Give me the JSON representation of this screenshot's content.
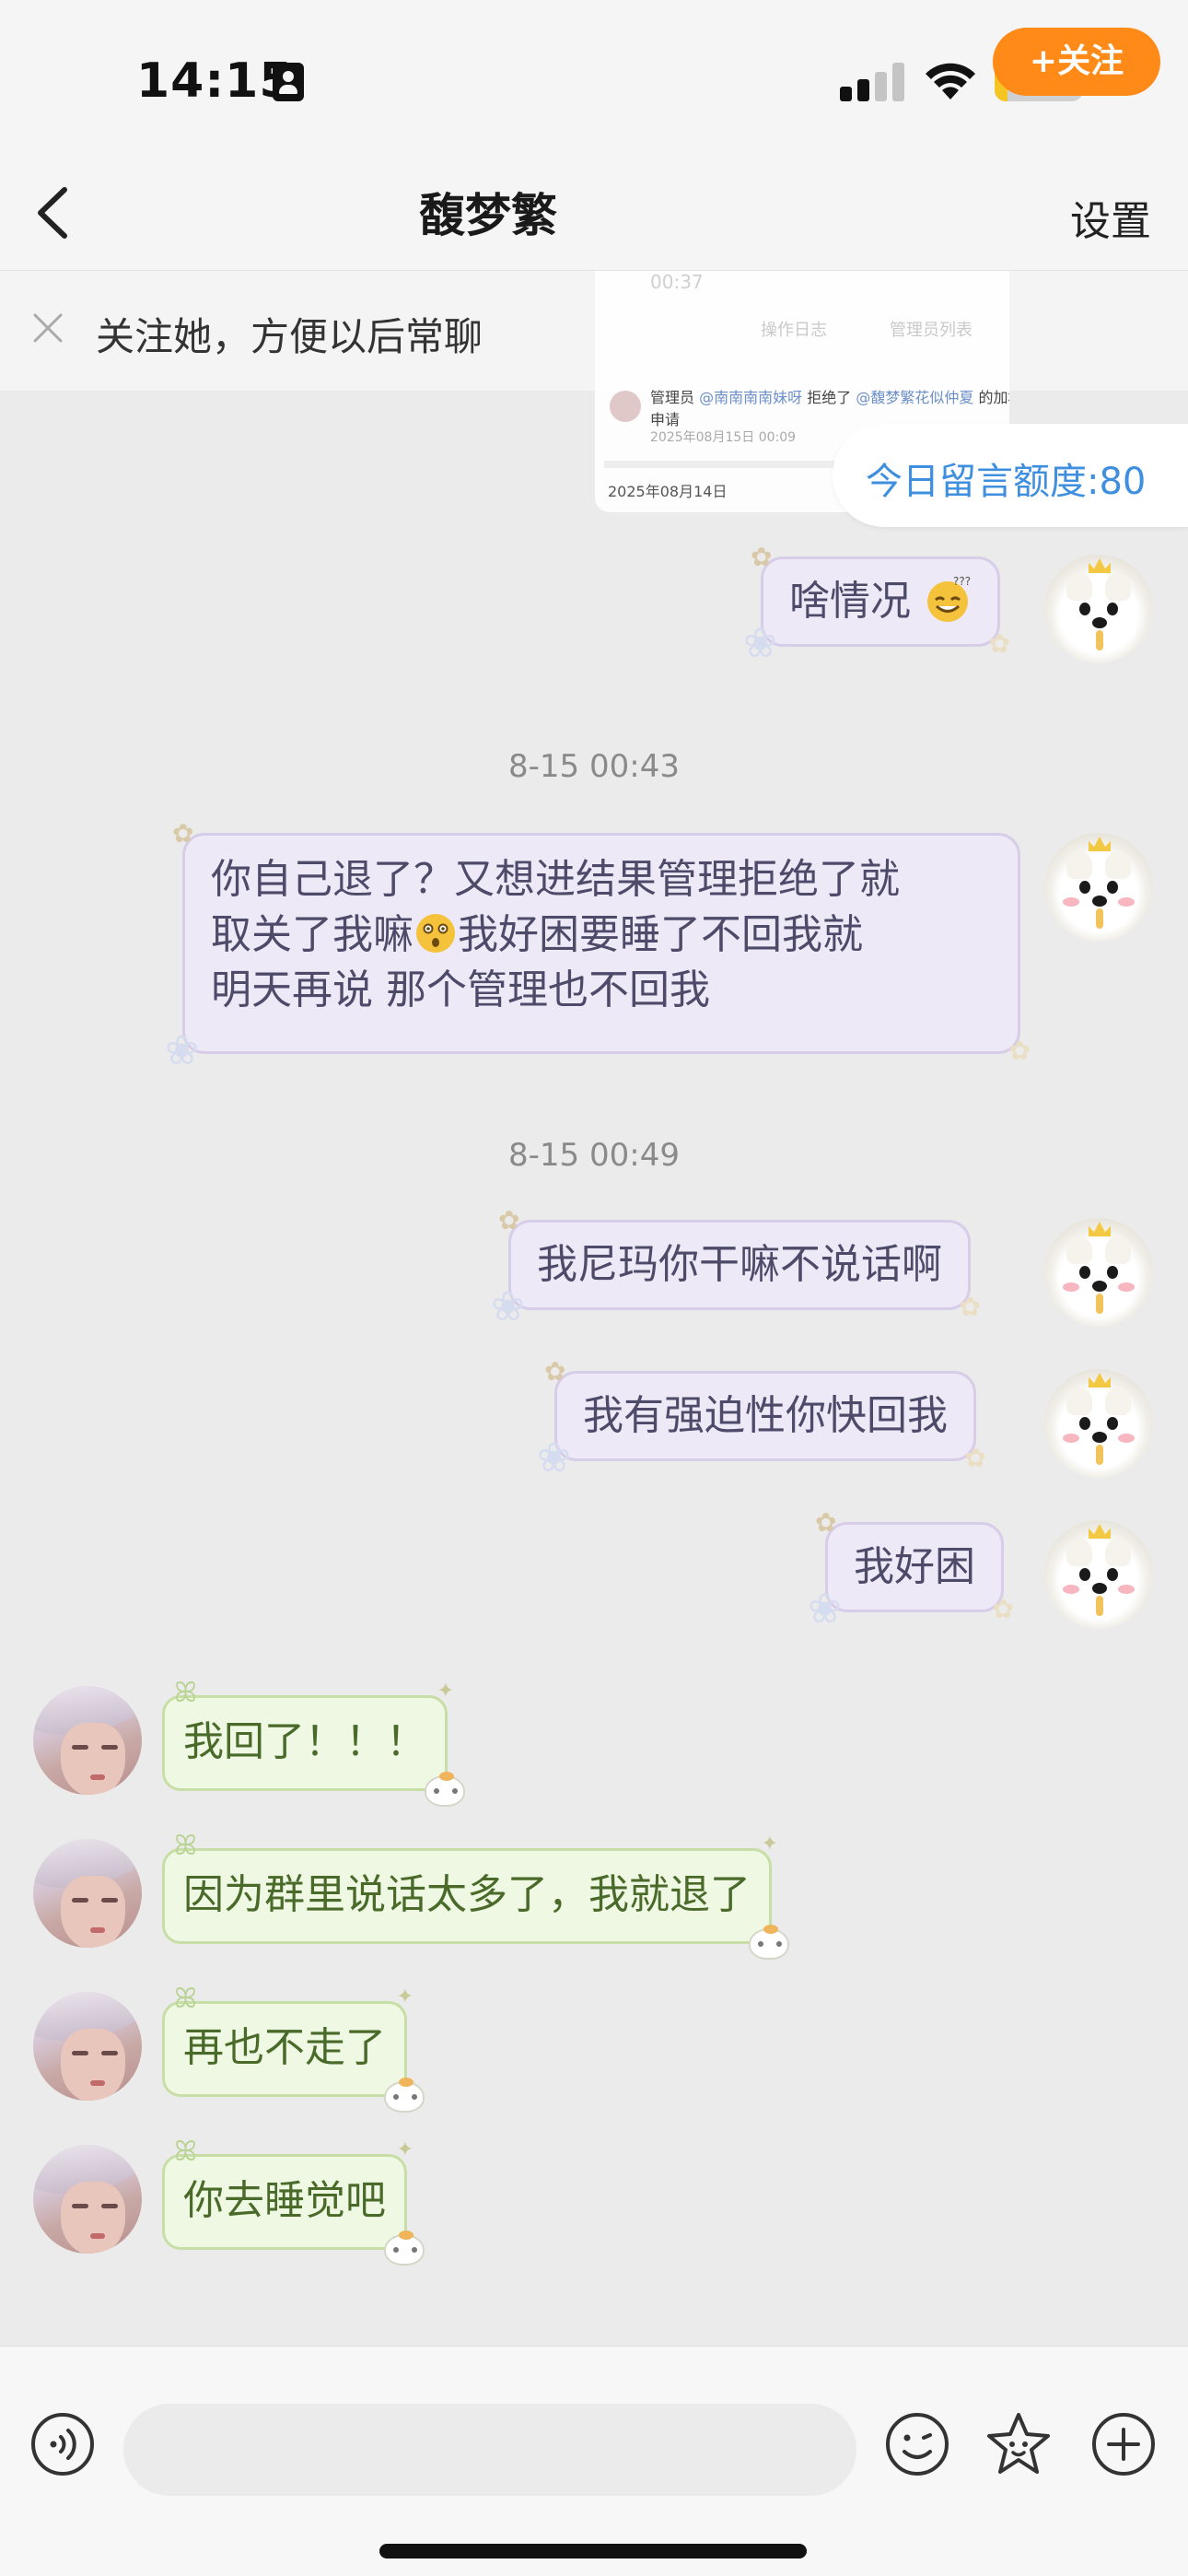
{
  "status_bar": {
    "time": "14:15",
    "battery": "15",
    "battery_level": 0.15,
    "colors": {
      "battery_fill": "#f5c623"
    }
  },
  "nav": {
    "title": "馥梦繁",
    "settings_label": "设置"
  },
  "follow_banner": {
    "text": "关注她，方便以后常聊",
    "button_label": "+关注",
    "colors": {
      "button": "#ff8a18"
    }
  },
  "preview_screenshot": {
    "time": "00:37",
    "tabs": [
      "操作日志",
      "管理员列表"
    ],
    "admin_label": "管理员",
    "admin_user": "@南南南南妹呀",
    "action": "拒绝了",
    "target_user": "@馥梦繁花似仲夏",
    "request_suffix": "的加群",
    "request_line2": "申请",
    "entry_time": "2025年08月15日 00:09",
    "date": "2025年08月14日"
  },
  "quota": {
    "text": "今日留言额度:80"
  },
  "messages": [
    {
      "side": "right",
      "text": "啥情况",
      "emoji": "sweat-smile-emoji"
    },
    {
      "timestamp": "8-15 00:43"
    },
    {
      "side": "right",
      "lines": [
        "你自己退了？又想进结果管理拒绝了就",
        "取关了我嘛",
        "我好困要睡了不回我就",
        "明天再说 那个管理也不回我"
      ]
    },
    {
      "timestamp": "8-15 00:49"
    },
    {
      "side": "right",
      "text": "我尼玛你干嘛不说话啊"
    },
    {
      "side": "right",
      "text": "我有强迫性你快回我"
    },
    {
      "side": "right",
      "text": "我好困"
    },
    {
      "side": "left",
      "text": "我回了！！！"
    },
    {
      "side": "left",
      "text": "因为群里说话太多了，我就退了"
    },
    {
      "side": "left",
      "text": "再也不走了"
    },
    {
      "side": "left",
      "text": "你去睡觉吧"
    }
  ],
  "input_bar": {
    "placeholder": "",
    "icons": [
      "voice-icon",
      "emoji-icon",
      "sticker-icon",
      "plus-icon"
    ]
  }
}
